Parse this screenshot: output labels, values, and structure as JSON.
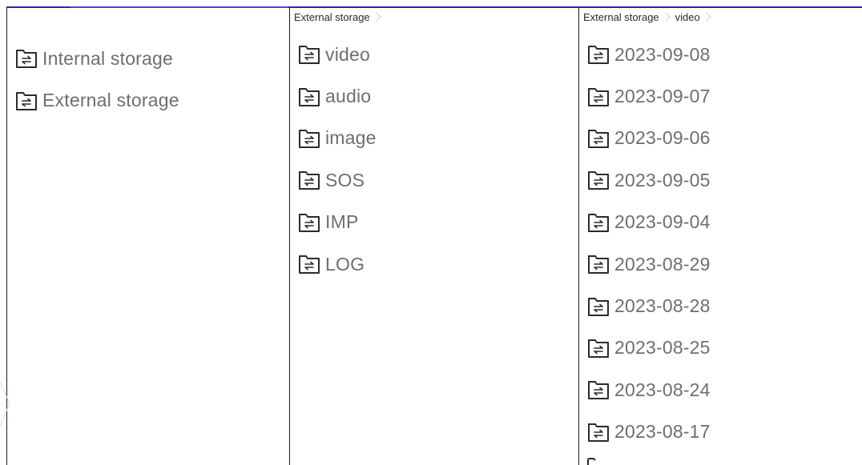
{
  "pane_root": {
    "items": [
      {
        "label": "Internal storage",
        "icon": "folder-sync-icon"
      },
      {
        "label": "External storage",
        "icon": "folder-sync-icon"
      }
    ]
  },
  "pane_external": {
    "breadcrumb": [
      "External storage"
    ],
    "items": [
      {
        "label": "video",
        "icon": "folder-sync-icon"
      },
      {
        "label": "audio",
        "icon": "folder-sync-icon"
      },
      {
        "label": "image",
        "icon": "folder-sync-icon"
      },
      {
        "label": "SOS",
        "icon": "folder-sync-icon"
      },
      {
        "label": "IMP",
        "icon": "folder-sync-icon"
      },
      {
        "label": "LOG",
        "icon": "folder-sync-icon"
      }
    ]
  },
  "pane_video": {
    "breadcrumb": [
      "External storage",
      "video"
    ],
    "items": [
      {
        "label": "2023-09-08",
        "icon": "folder-sync-icon"
      },
      {
        "label": "2023-09-07",
        "icon": "folder-sync-icon"
      },
      {
        "label": "2023-09-06",
        "icon": "folder-sync-icon"
      },
      {
        "label": "2023-09-05",
        "icon": "folder-sync-icon"
      },
      {
        "label": "2023-09-04",
        "icon": "folder-sync-icon"
      },
      {
        "label": "2023-08-29",
        "icon": "folder-sync-icon"
      },
      {
        "label": "2023-08-28",
        "icon": "folder-sync-icon"
      },
      {
        "label": "2023-08-25",
        "icon": "folder-sync-icon"
      },
      {
        "label": "2023-08-24",
        "icon": "folder-sync-icon"
      },
      {
        "label": "2023-08-17",
        "icon": "folder-sync-icon"
      }
    ]
  },
  "colors": {
    "accent": "#3a1fa8",
    "label_text": "#6e6e6e",
    "breadcrumb_text": "#2a2a2a",
    "divider": "#1a1a1a"
  }
}
